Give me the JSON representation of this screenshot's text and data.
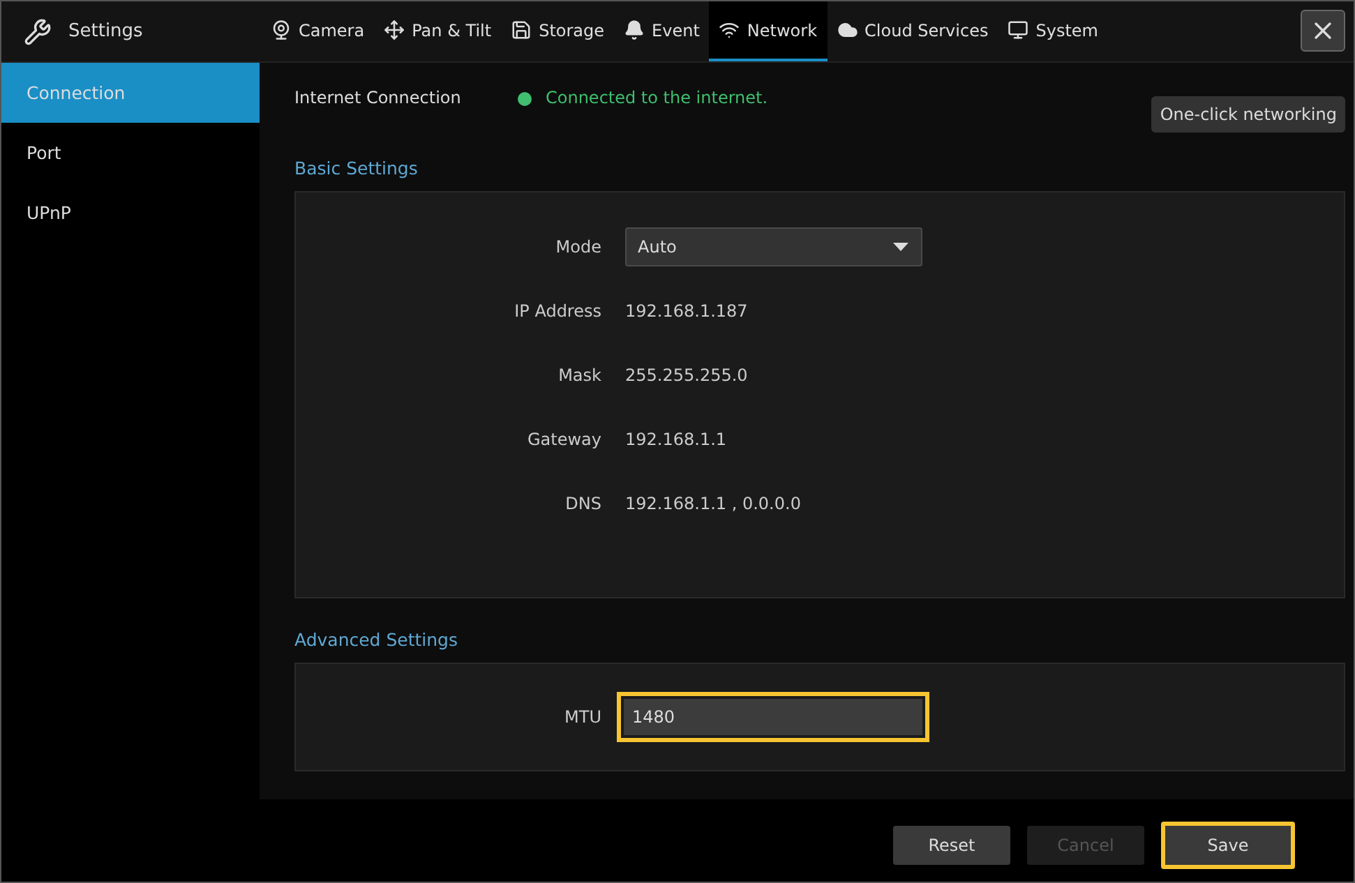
{
  "header": {
    "title": "Settings"
  },
  "tabs": [
    {
      "label": "Camera",
      "selected": false
    },
    {
      "label": "Pan & Tilt",
      "selected": false
    },
    {
      "label": "Storage",
      "selected": false
    },
    {
      "label": "Event",
      "selected": false
    },
    {
      "label": "Network",
      "selected": true
    },
    {
      "label": "Cloud Services",
      "selected": false
    },
    {
      "label": "System",
      "selected": false
    }
  ],
  "sidebar": {
    "items": [
      {
        "label": "Connection",
        "selected": true
      },
      {
        "label": "Port",
        "selected": false
      },
      {
        "label": "UPnP",
        "selected": false
      }
    ]
  },
  "internet_connection": {
    "label": "Internet Connection",
    "status": "Connected to the internet.",
    "color": "#3fbf6f",
    "button": "One-click networking"
  },
  "basic_settings": {
    "title": "Basic Settings",
    "mode": {
      "label": "Mode",
      "value": "Auto"
    },
    "fields": [
      {
        "label": "IP Address",
        "value": "192.168.1.187"
      },
      {
        "label": "Mask",
        "value": "255.255.255.0"
      },
      {
        "label": "Gateway",
        "value": "192.168.1.1"
      },
      {
        "label": "DNS",
        "value": "192.168.1.1 , 0.0.0.0"
      }
    ]
  },
  "advanced_settings": {
    "title": "Advanced Settings",
    "mtu": {
      "label": "MTU",
      "value": "1480",
      "highlighted": true
    }
  },
  "buttons": [
    {
      "label": "Reset",
      "disabled": false,
      "highlighted": false
    },
    {
      "label": "Cancel",
      "disabled": true,
      "highlighted": false
    },
    {
      "label": "Save",
      "disabled": false,
      "highlighted": true
    }
  ]
}
